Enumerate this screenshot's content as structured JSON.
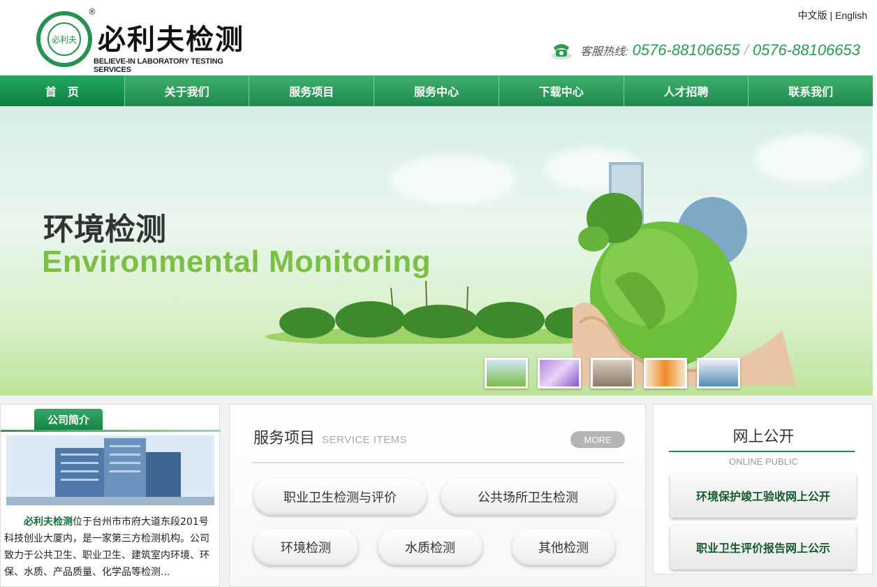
{
  "header": {
    "logo_cn": "必利夫检测",
    "logo_en": "BELIEVE-IN LABORATORY TESTING SERVICES",
    "logo_badge": "必利夫",
    "logo_reg": "®",
    "lang_cn": "中文版",
    "lang_sep": "|",
    "lang_en": "English",
    "hotline_label": "客服热线:",
    "phone1": "0576-88106655",
    "phone_sep": "/",
    "phone2": "0576-88106653"
  },
  "nav": {
    "items": [
      {
        "label": "首　页"
      },
      {
        "label": "关于我们"
      },
      {
        "label": "服务项目"
      },
      {
        "label": "服务中心"
      },
      {
        "label": "下载中心"
      },
      {
        "label": "人才招聘"
      },
      {
        "label": "联系我们"
      }
    ]
  },
  "banner": {
    "title_cn": "环境检测",
    "title_en": "Environmental Monitoring",
    "colors": {
      "accent_green": "#7bc043",
      "nav_green": "#1f8a4c"
    }
  },
  "about": {
    "tab_label": "公司简介",
    "company": "必利夫检测",
    "text": "位于台州市市府大道东段201号科技创业大厦内，是一家第三方检测机构。公司致力于公共卫生、职业卫生、建筑室内环境、环保、水质、产品质量、化学品等检测..."
  },
  "services": {
    "title": "服务项目",
    "subtitle": "SERVICE ITEMS",
    "more": "MORE",
    "items": [
      {
        "label": "职业卫生检测与评价"
      },
      {
        "label": "公共场所卫生检测"
      },
      {
        "label": "环境检测"
      },
      {
        "label": "水质检测"
      },
      {
        "label": "其他检测"
      }
    ]
  },
  "public": {
    "title": "网上公开",
    "subtitle": "ONLINE PUBLIC",
    "buttons": [
      {
        "label": "环境保护竣工验收网上公开"
      },
      {
        "label": "职业卫生评价报告网上公示"
      }
    ]
  }
}
